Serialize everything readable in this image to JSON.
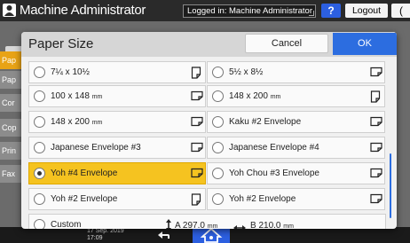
{
  "topbar": {
    "title": "Machine Administrator",
    "login_status": "Logged in: Machine Administrator",
    "help_label": "?",
    "logout_label": "Logout",
    "extra_label": "("
  },
  "background": {
    "tabs": [
      "Pap",
      "Pap",
      "Cor",
      "Cop",
      "Prin",
      "Fax"
    ]
  },
  "bottombar": {
    "date": "17 Sep. 2019",
    "time": "17:09"
  },
  "dialog": {
    "title": "Paper Size",
    "cancel_label": "Cancel",
    "ok_label": "OK",
    "rows": [
      {
        "left": {
          "label": "7¼ x 10½",
          "orientation": "portrait",
          "selected": false
        },
        "right": {
          "label": "5½ x 8½",
          "orientation": "landscape",
          "selected": false
        }
      },
      {
        "left": {
          "label": "100 x 148",
          "unit": "mm",
          "orientation": "landscape",
          "selected": false
        },
        "right": {
          "label": "148 x 200",
          "unit": "mm",
          "orientation": "portrait",
          "selected": false
        }
      },
      {
        "left": {
          "label": "148 x 200",
          "unit": "mm",
          "orientation": "landscape",
          "selected": false
        },
        "right": {
          "label": "Kaku #2 Envelope",
          "orientation": "landscape",
          "selected": false
        }
      },
      {
        "left": {
          "label": "Japanese Envelope #3",
          "orientation": "landscape",
          "selected": false
        },
        "right": {
          "label": "Japanese Envelope #4",
          "orientation": "landscape",
          "selected": false
        }
      },
      {
        "left": {
          "label": "Yoh #4 Envelope",
          "orientation": "landscape",
          "selected": true
        },
        "right": {
          "label": "Yoh Chou #3 Envelope",
          "orientation": "landscape",
          "selected": false
        }
      },
      {
        "left": {
          "label": "Yoh #2 Envelope",
          "orientation": "portrait",
          "selected": false
        },
        "right": {
          "label": "Yoh #2 Envelope",
          "orientation": "landscape",
          "selected": false
        }
      }
    ],
    "custom": {
      "label": "Custom",
      "a_value": "A 297.0",
      "a_unit": "mm",
      "b_value": "B 210.0",
      "b_unit": "mm"
    }
  },
  "colors": {
    "accent": "#2c6de0",
    "selected": "#f5c320",
    "background_tab_active": "#e8a316"
  },
  "icons": {
    "portrait": "paper-portrait-icon",
    "landscape": "paper-landscape-icon"
  }
}
